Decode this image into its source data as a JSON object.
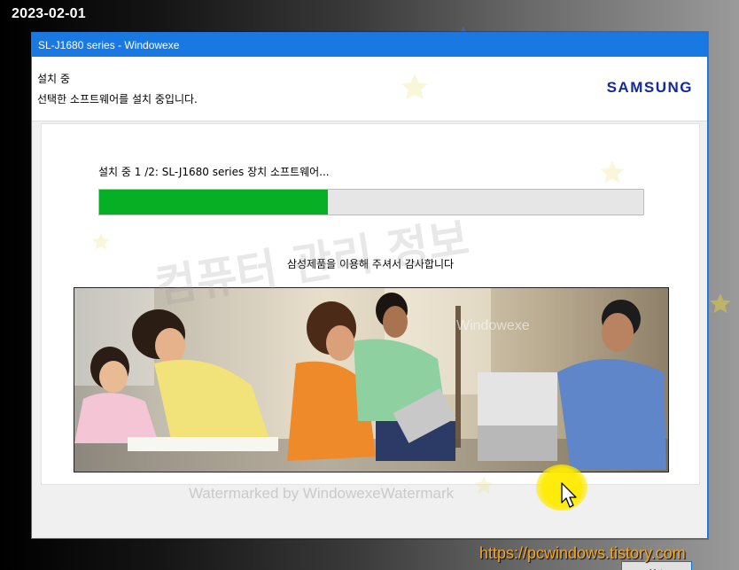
{
  "date_stamp": "2023-02-01",
  "site_url": "https://pcwindows.tistory.com",
  "window": {
    "title": "SL-J1680 series   - Windowexe"
  },
  "header": {
    "title": "설치 중",
    "subtitle": "선택한 소프트웨어를 설치 중입니다.",
    "logo": "SAMSUNG"
  },
  "progress": {
    "status_text": "설치 중 1 /2: SL-J1680 series 장치 소프트웨어...",
    "fraction": 0.42
  },
  "thanks_text": "삼성제품을 이용해 주셔서 감사합니다",
  "buttons": {
    "cancel_label": "취소"
  },
  "watermarks": {
    "bottom": "Watermarked by WindowexeWatermark",
    "big": "컴퓨터 관리 정보",
    "mid": "Windowexe"
  },
  "colors": {
    "titlebar": "#1a78e3",
    "progress_fill": "#06b025",
    "logo": "#1428a0",
    "url": "#f5a623"
  },
  "icons": [
    "star-icon",
    "mouse-cursor-icon"
  ]
}
